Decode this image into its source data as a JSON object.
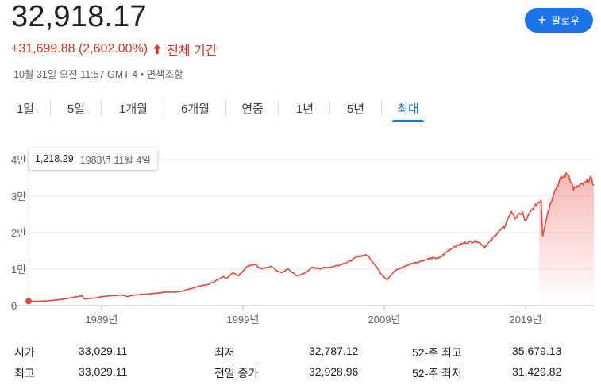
{
  "quote": {
    "price": "32,918.17",
    "change": "+31,699.88 (2,602.00%)",
    "period": "전체 기간",
    "timestamp": "10월 31일 오전 11:57 GMT-4 • 면책조항"
  },
  "follow_button": {
    "label": "팔로우",
    "icon": "plus-icon"
  },
  "tabs": [
    {
      "label": "1일"
    },
    {
      "label": "5일"
    },
    {
      "label": "1개월"
    },
    {
      "label": "6개월"
    },
    {
      "label": "연중"
    },
    {
      "label": "1년"
    },
    {
      "label": "5년"
    },
    {
      "label": "최대",
      "active": true
    }
  ],
  "tooltip": {
    "value": "1,218.29",
    "date": "1983년 11월 4일"
  },
  "stats": [
    {
      "label": "시가",
      "value": "33,029.11"
    },
    {
      "label": "최저",
      "value": "32,787.12"
    },
    {
      "label": "52-주 최고",
      "value": "35,679.13"
    },
    {
      "label": "최고",
      "value": "33,029.11"
    },
    {
      "label": "전일 종가",
      "value": "32,928.96"
    },
    {
      "label": "52-주 최저",
      "value": "31,429.82"
    }
  ],
  "colors": {
    "line": "#e8453c",
    "accent": "#1a73e8",
    "negative_up": "#d93025"
  },
  "chart_data": {
    "type": "line",
    "title": "",
    "xlabel": "",
    "ylabel": "",
    "xlim": [
      1983.84,
      2023.83
    ],
    "ylim": [
      0,
      40000
    ],
    "yticks": [
      0,
      10000,
      20000,
      30000,
      40000
    ],
    "ytick_labels": [
      "0",
      "1만",
      "2만",
      "3만",
      "4만"
    ],
    "xticks": [
      1989,
      1999,
      2009,
      2019
    ],
    "xtick_labels": [
      "1989년",
      "1999년",
      "2009년",
      "2019년"
    ],
    "grid": true,
    "series": [
      {
        "x": [
          1983.84,
          1984.5,
          1985.5,
          1986.5,
          1987.6,
          1987.8,
          1988.5,
          1989.5,
          1990.5,
          1990.8,
          1991.5,
          1992.5,
          1993.5,
          1994.5,
          1995.5,
          1996.0,
          1996.5,
          1997.0,
          1997.6,
          1997.8,
          1998.3,
          1998.7,
          1999.3,
          1999.9,
          2000.2,
          2001.0,
          2001.7,
          2002.2,
          2002.8,
          2003.3,
          2003.9,
          2004.5,
          2005.5,
          2006.5,
          2007.2,
          2007.8,
          2008.3,
          2008.8,
          2009.2,
          2009.8,
          2010.3,
          2010.9,
          2011.6,
          2012.3,
          2012.9,
          2013.5,
          2014.0,
          2014.8,
          2015.6,
          2016.1,
          2016.6,
          2017.0,
          2017.5,
          2018.0,
          2018.2,
          2018.8,
          2018.95,
          2019.5,
          2020.1,
          2020.2,
          2020.6,
          2021.0,
          2021.5,
          2022.0,
          2022.4,
          2022.8,
          2023.2,
          2023.6,
          2023.83
        ],
        "y": [
          1218,
          1150,
          1400,
          1900,
          2700,
          1800,
          2100,
          2700,
          2900,
          2500,
          3000,
          3300,
          3700,
          3800,
          4800,
          5400,
          5700,
          6600,
          8000,
          7400,
          9000,
          8200,
          10800,
          11400,
          10200,
          10600,
          9000,
          10000,
          8200,
          8700,
          10400,
          10200,
          10800,
          12000,
          13600,
          13800,
          11500,
          8600,
          7100,
          9700,
          10500,
          11500,
          12200,
          13000,
          13000,
          15000,
          16300,
          17300,
          17700,
          16100,
          18000,
          20000,
          21500,
          26000,
          24000,
          25500,
          23000,
          26500,
          29000,
          19200,
          26000,
          31000,
          34800,
          36200,
          32000,
          32800,
          33500,
          34800,
          32918
        ]
      }
    ]
  }
}
